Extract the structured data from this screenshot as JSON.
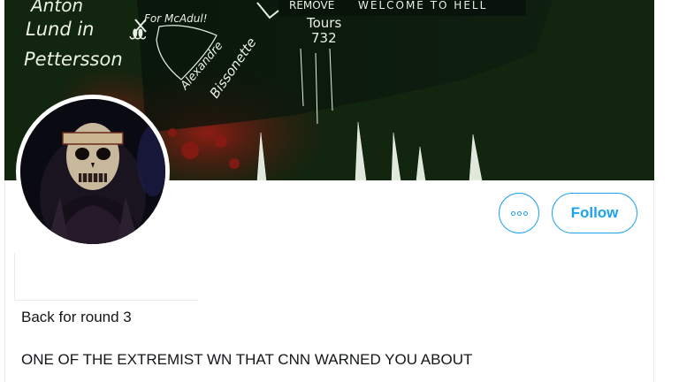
{
  "header": {
    "banner_texts": [
      "Anton",
      "Lund in",
      "Pettersson",
      "For McAdul!",
      "Alexandre",
      "Bissonette",
      "REMOVE",
      "Tours",
      "732",
      "WELCOME TO HELL"
    ]
  },
  "profile": {
    "more_icon": "more-dots-icon",
    "follow_label": "Follow",
    "bio_lines": [
      "Back for round 3",
      "ONE OF THE EXTREMIST WN THAT CNN WARNED YOU ABOUT"
    ]
  },
  "colors": {
    "accent": "#1da1f2",
    "banner_bg": "#12250f",
    "text": "#14171a",
    "border": "#e6ecf0"
  }
}
